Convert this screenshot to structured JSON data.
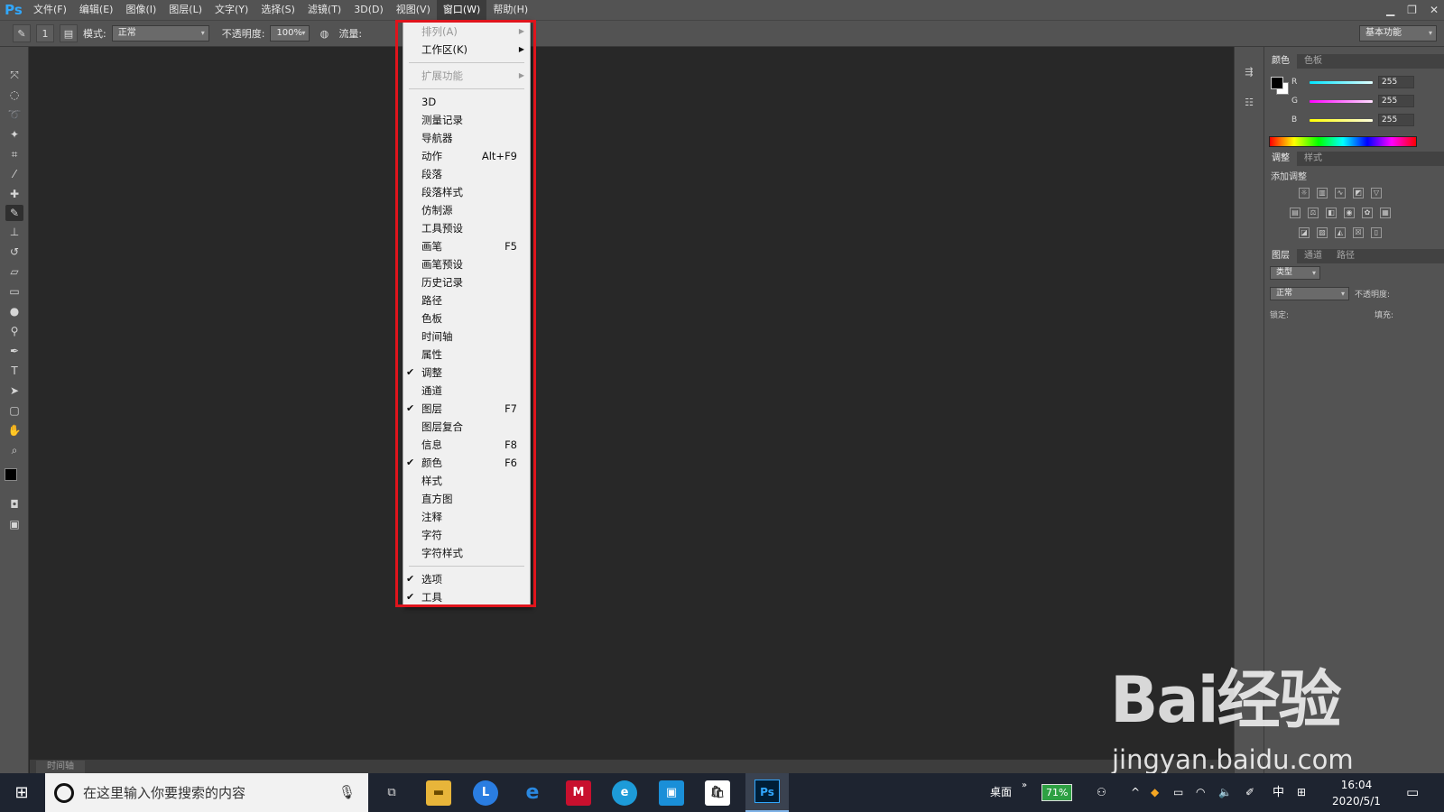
{
  "app": {
    "logo": "Ps",
    "menu": [
      "文件(F)",
      "编辑(E)",
      "图像(I)",
      "图层(L)",
      "文字(Y)",
      "选择(S)",
      "滤镜(T)",
      "3D(D)",
      "视图(V)",
      "窗口(W)",
      "帮助(H)"
    ],
    "active_menu": "窗口(W)"
  },
  "options_bar": {
    "mode_label": "模式:",
    "mode_value": "正常",
    "opacity_label": "不透明度:",
    "opacity_value": "100%",
    "flow_label": "流量:",
    "brush_size": "1",
    "workspace": "基本功能"
  },
  "window_menu": {
    "items": [
      {
        "label": "排列(A)",
        "shortcut": "",
        "checked": false,
        "submenu": true,
        "disabled": true
      },
      {
        "label": "工作区(K)",
        "shortcut": "",
        "checked": false,
        "submenu": true,
        "disabled": false
      },
      {
        "label": "扩展功能",
        "shortcut": "",
        "checked": false,
        "submenu": true,
        "disabled": true
      },
      {
        "label": "3D",
        "shortcut": "",
        "checked": false
      },
      {
        "label": "测量记录",
        "shortcut": "",
        "checked": false
      },
      {
        "label": "导航器",
        "shortcut": "",
        "checked": false
      },
      {
        "label": "动作",
        "shortcut": "Alt+F9",
        "checked": false
      },
      {
        "label": "段落",
        "shortcut": "",
        "checked": false
      },
      {
        "label": "段落样式",
        "shortcut": "",
        "checked": false
      },
      {
        "label": "仿制源",
        "shortcut": "",
        "checked": false
      },
      {
        "label": "工具预设",
        "shortcut": "",
        "checked": false
      },
      {
        "label": "画笔",
        "shortcut": "F5",
        "checked": false
      },
      {
        "label": "画笔预设",
        "shortcut": "",
        "checked": false
      },
      {
        "label": "历史记录",
        "shortcut": "",
        "checked": false
      },
      {
        "label": "路径",
        "shortcut": "",
        "checked": false
      },
      {
        "label": "色板",
        "shortcut": "",
        "checked": false
      },
      {
        "label": "时间轴",
        "shortcut": "",
        "checked": false
      },
      {
        "label": "属性",
        "shortcut": "",
        "checked": false
      },
      {
        "label": "调整",
        "shortcut": "",
        "checked": true
      },
      {
        "label": "通道",
        "shortcut": "",
        "checked": false
      },
      {
        "label": "图层",
        "shortcut": "F7",
        "checked": true
      },
      {
        "label": "图层复合",
        "shortcut": "",
        "checked": false
      },
      {
        "label": "信息",
        "shortcut": "F8",
        "checked": false
      },
      {
        "label": "颜色",
        "shortcut": "F6",
        "checked": true
      },
      {
        "label": "样式",
        "shortcut": "",
        "checked": false
      },
      {
        "label": "直方图",
        "shortcut": "",
        "checked": false
      },
      {
        "label": "注释",
        "shortcut": "",
        "checked": false
      },
      {
        "label": "字符",
        "shortcut": "",
        "checked": false
      },
      {
        "label": "字符样式",
        "shortcut": "",
        "checked": false
      },
      {
        "label": "选项",
        "shortcut": "",
        "checked": true
      },
      {
        "label": "工具",
        "shortcut": "",
        "checked": true
      }
    ],
    "highlight_color": "#e0141c"
  },
  "panels": {
    "color_tabs": [
      "颜色",
      "色板"
    ],
    "color_channels": [
      {
        "name": "R",
        "value": "255",
        "color": "#00e5ff"
      },
      {
        "name": "G",
        "value": "255",
        "color": "#ff00ff"
      },
      {
        "name": "B",
        "value": "255",
        "color": "#ffff00"
      }
    ],
    "adjust_tabs": [
      "调整",
      "样式"
    ],
    "adjust_heading": "添加调整",
    "layer_tabs": [
      "图层",
      "通道",
      "路径"
    ],
    "layer_filter": "类型",
    "blend_mode": "正常",
    "opacity_label": "不透明度:",
    "lock_label": "锁定:",
    "fill_label": "填充:"
  },
  "timeline_tab": "时间轴",
  "watermark": {
    "logo": "Bai经验",
    "url": "jingyan.baidu.com"
  },
  "taskbar": {
    "search_placeholder": "在这里输入你要搜索的内容",
    "desktop_label": "桌面",
    "battery": "71%",
    "ime": "中",
    "time": "16:04",
    "date": "2020/5/1"
  }
}
